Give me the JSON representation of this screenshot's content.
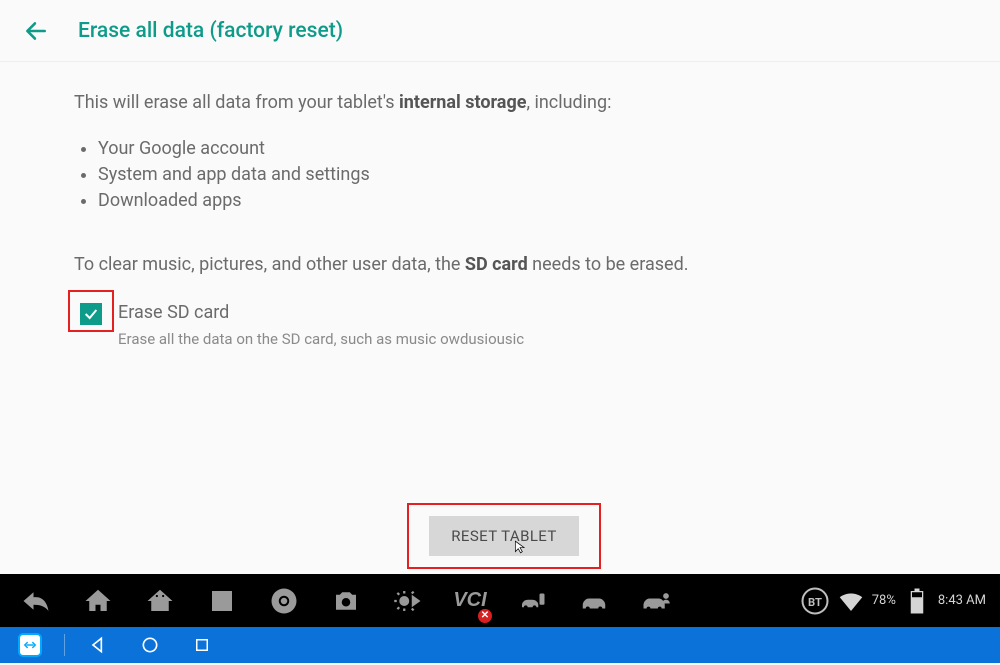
{
  "header": {
    "title": "Erase all data (factory reset)"
  },
  "content": {
    "intro_before": "This will erase all data from your tablet's ",
    "intro_bold": "internal storage",
    "intro_after": ", including:",
    "bullets": [
      "Your Google account",
      "System and app data and settings",
      "Downloaded apps"
    ],
    "sd_note_before": "To clear music, pictures, and other user data, the ",
    "sd_note_bold": "SD card",
    "sd_note_after": " needs to be erased.",
    "sd_label": "Erase SD card",
    "sd_sub": "Erase all the data on the SD card, such as music owdusiousic",
    "reset_button": "RESET TABLET"
  },
  "status": {
    "battery_pct": "78%",
    "time": "8:43 AM",
    "bt_label": "BT"
  }
}
